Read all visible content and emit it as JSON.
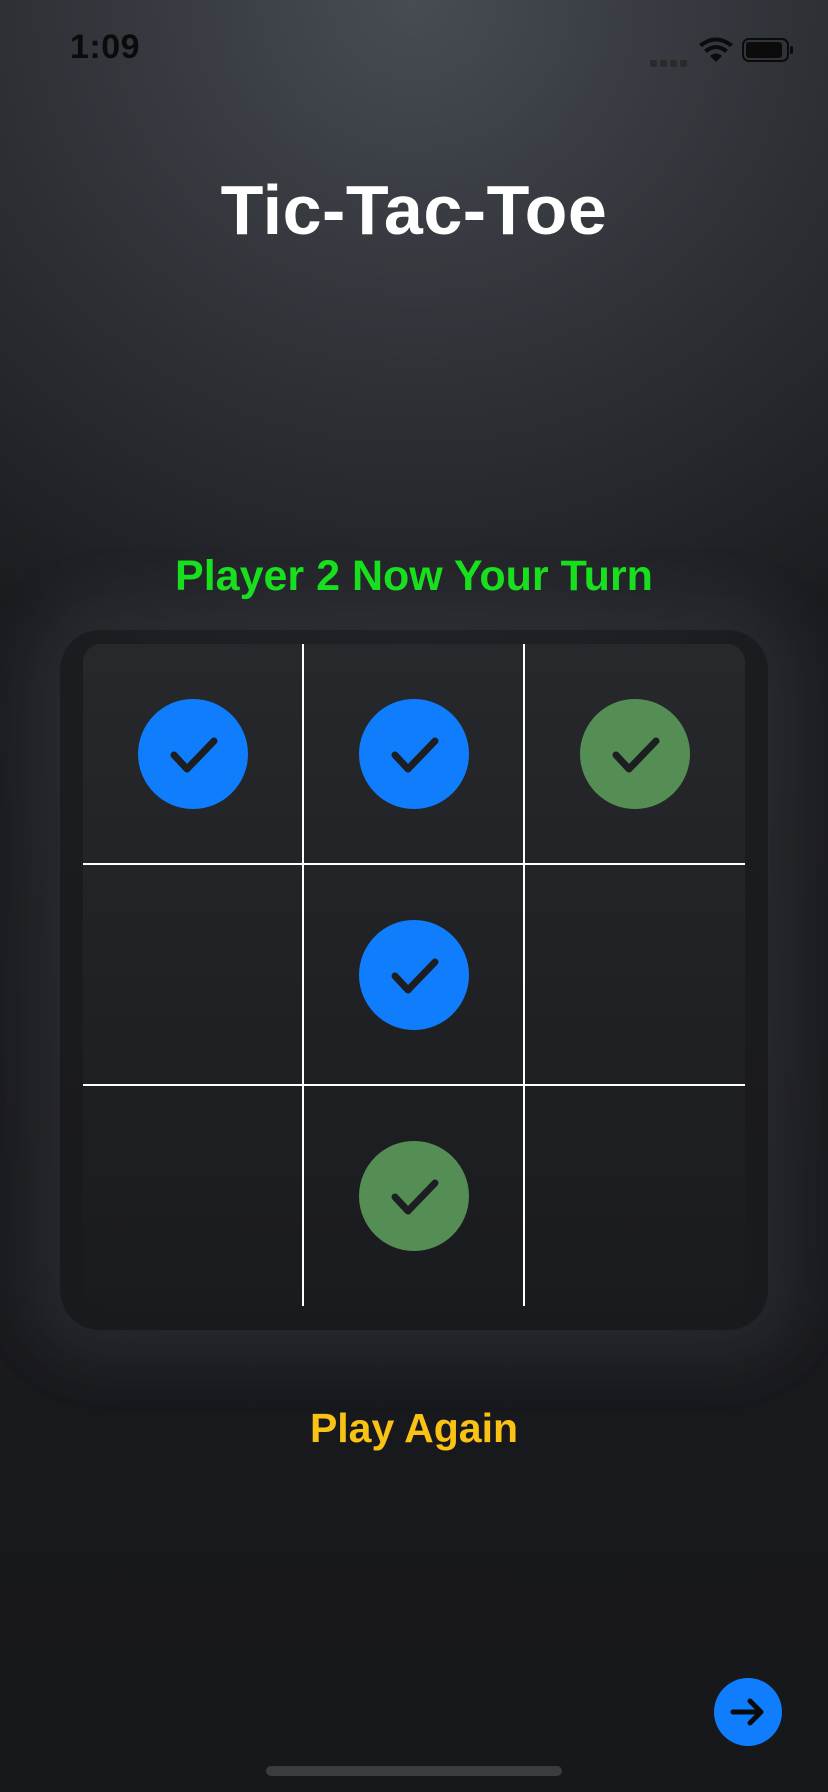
{
  "status_bar": {
    "time": "1:09"
  },
  "app": {
    "title": "Tic-Tac-Toe",
    "turn_label": "Player 2 Now Your Turn",
    "play_again_label": "Play Again"
  },
  "colors": {
    "player1_mark": "#0f7dfc",
    "player2_mark": "#558e55",
    "turn_label": "#16e21b",
    "play_again": "#f9c214"
  },
  "board": {
    "cells": [
      {
        "mark": "player1",
        "icon": "checkmark-icon"
      },
      {
        "mark": "player1",
        "icon": "checkmark-icon"
      },
      {
        "mark": "player2",
        "icon": "checkmark-icon"
      },
      {
        "mark": "empty"
      },
      {
        "mark": "player1",
        "icon": "checkmark-icon"
      },
      {
        "mark": "empty"
      },
      {
        "mark": "empty"
      },
      {
        "mark": "player2",
        "icon": "checkmark-icon"
      },
      {
        "mark": "empty"
      }
    ]
  },
  "icons": {
    "next": "arrow-right-icon",
    "wifi": "wifi-icon",
    "battery": "battery-icon",
    "signal": "signal-icon"
  }
}
